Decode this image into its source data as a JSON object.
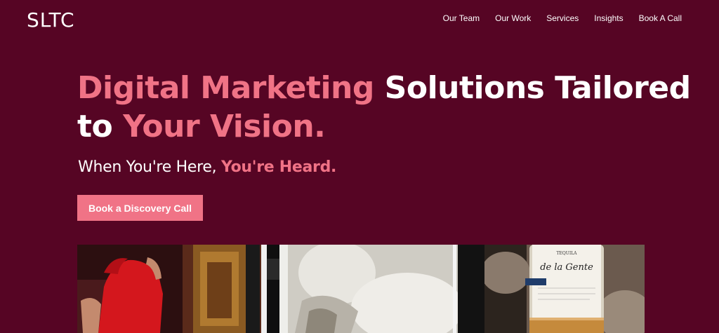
{
  "brand": {
    "logo_text": "SLTC"
  },
  "nav": {
    "items": [
      "Our Team",
      "Our Work",
      "Services",
      "Insights",
      "Book A Call"
    ]
  },
  "hero": {
    "title_part1": "Digital Marketing",
    "title_part2": " Solutions Tailored to ",
    "title_part3": "Your Vision.",
    "tagline_part1": "When You're Here, ",
    "tagline_part2": "You're Heard.",
    "cta_label": "Book a Discovery Call"
  },
  "gallery": {
    "tiles": [
      {
        "icon": "woman-in-red-dress-photo"
      },
      {
        "icon": "white-shirt-blurred-photo"
      },
      {
        "icon": "tequila-de-la-gente-bottle-photo",
        "bottle_label": "de la Gente",
        "bottle_sublabel": "TEQUILA"
      }
    ]
  },
  "colors": {
    "background": "#560524",
    "accent": "#f07386",
    "text": "#ffffff"
  }
}
